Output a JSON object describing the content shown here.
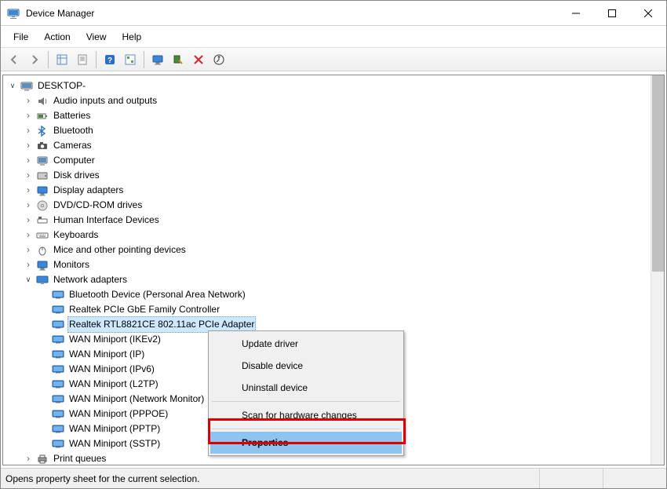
{
  "window": {
    "title": "Device Manager"
  },
  "menu": {
    "items": [
      "File",
      "Action",
      "View",
      "Help"
    ]
  },
  "toolbar_icons": [
    "nav-back-icon",
    "nav-forward-icon",
    "sep",
    "show-hide-tree-icon",
    "properties-icon",
    "sep",
    "help-icon",
    "options-icon",
    "sep",
    "monitor-icon",
    "scan-hardware-icon",
    "delete-icon",
    "update-driver-icon"
  ],
  "tree": {
    "root": {
      "label": "DESKTOP-",
      "icon": "computer-root"
    },
    "categories": [
      {
        "label": "Audio inputs and outputs",
        "icon": "audio"
      },
      {
        "label": "Batteries",
        "icon": "battery"
      },
      {
        "label": "Bluetooth",
        "icon": "bluetooth"
      },
      {
        "label": "Cameras",
        "icon": "camera"
      },
      {
        "label": "Computer",
        "icon": "computer"
      },
      {
        "label": "Disk drives",
        "icon": "disk"
      },
      {
        "label": "Display adapters",
        "icon": "display"
      },
      {
        "label": "DVD/CD-ROM drives",
        "icon": "dvd"
      },
      {
        "label": "Human Interface Devices",
        "icon": "hid"
      },
      {
        "label": "Keyboards",
        "icon": "keyboard"
      },
      {
        "label": "Mice and other pointing devices",
        "icon": "mouse"
      },
      {
        "label": "Monitors",
        "icon": "monitor"
      },
      {
        "label": "Network adapters",
        "icon": "network",
        "expanded": true,
        "children": [
          {
            "label": "Bluetooth Device (Personal Area Network)"
          },
          {
            "label": "Realtek PCIe GbE Family Controller"
          },
          {
            "label": "Realtek RTL8821CE 802.11ac PCIe Adapter",
            "selected": true
          },
          {
            "label": "WAN Miniport (IKEv2)"
          },
          {
            "label": "WAN Miniport (IP)"
          },
          {
            "label": "WAN Miniport (IPv6)"
          },
          {
            "label": "WAN Miniport (L2TP)"
          },
          {
            "label": "WAN Miniport (Network Monitor)"
          },
          {
            "label": "WAN Miniport (PPPOE)"
          },
          {
            "label": "WAN Miniport (PPTP)"
          },
          {
            "label": "WAN Miniport (SSTP)"
          }
        ]
      },
      {
        "label": "Print queues",
        "icon": "printer"
      }
    ]
  },
  "context_menu": {
    "items": [
      {
        "label": "Update driver"
      },
      {
        "label": "Disable device"
      },
      {
        "label": "Uninstall device"
      },
      {
        "sep": true
      },
      {
        "label": "Scan for hardware changes"
      },
      {
        "sep": true
      },
      {
        "label": "Properties",
        "highlight": true
      }
    ]
  },
  "statusbar": {
    "text": "Opens property sheet for the current selection."
  }
}
